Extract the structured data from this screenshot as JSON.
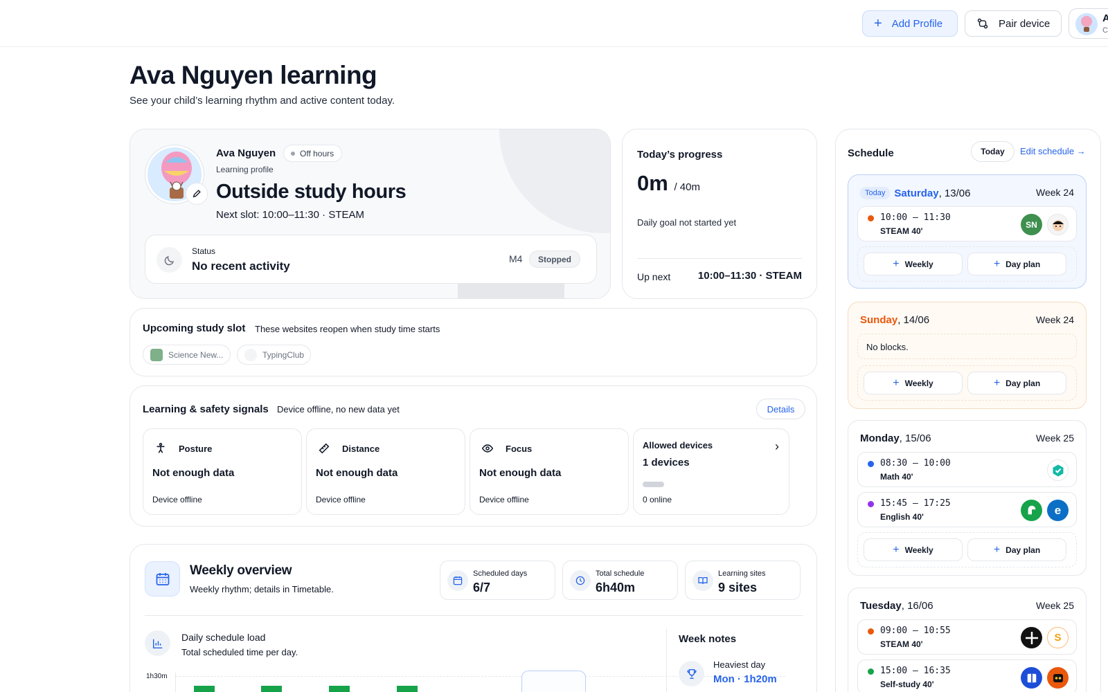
{
  "topbar": {
    "add_profile": "Add Profile",
    "pair_device": "Pair device",
    "user_initial": "A",
    "user_sub": "C"
  },
  "page": {
    "title": "Ava Nguyen learning",
    "subtitle": "See your child’s learning rhythm and active content today."
  },
  "profile": {
    "name": "Ava Nguyen",
    "badge": "Off hours",
    "label": "Learning profile",
    "headline": "Outside study hours",
    "next_slot": "Next slot: 10:00–11:30 · STEAM",
    "status_label": "Status",
    "status_value": "No recent activity",
    "device_code": "M4",
    "device_state": "Stopped"
  },
  "progress": {
    "title": "Today’s progress",
    "value": "0m",
    "goal": "/ 40m",
    "note": "Daily goal not started yet",
    "up_next_label": "Up next",
    "up_next_value": "10:00–11:30 · STEAM"
  },
  "upcoming": {
    "title": "Upcoming study slot",
    "subtitle": "These websites reopen when study time starts",
    "sites": [
      "Science New...",
      "TypingClub"
    ]
  },
  "signals": {
    "title": "Learning & safety signals",
    "subtitle": "Device offline, no new data yet",
    "details": "Details",
    "metrics": [
      {
        "label": "Posture",
        "value": "Not enough data",
        "sub": "Device offline",
        "icon": "posture-icon"
      },
      {
        "label": "Distance",
        "value": "Not enough data",
        "sub": "Device offline",
        "icon": "ruler-icon"
      },
      {
        "label": "Focus",
        "value": "Not enough data",
        "sub": "Device offline",
        "icon": "eye-icon"
      }
    ],
    "allowed": {
      "label": "Allowed devices",
      "value": "1 devices",
      "sub": "0 online"
    }
  },
  "weekly": {
    "title": "Weekly overview",
    "subtitle": "Weekly rhythm; details in Timetable.",
    "stats": [
      {
        "label": "Scheduled days",
        "value": "6/7",
        "icon": "calendar-icon"
      },
      {
        "label": "Total schedule",
        "value": "6h40m",
        "icon": "clock-icon"
      },
      {
        "label": "Learning sites",
        "value": "9 sites",
        "icon": "book-icon"
      }
    ],
    "chart_title": "Daily schedule load",
    "chart_sub": "Total scheduled time per day.",
    "y_tick": "1h30m",
    "notes_title": "Week notes",
    "heaviest_label": "Heaviest day",
    "heaviest_value": "Mon · 1h20m"
  },
  "chart_data": {
    "type": "bar",
    "title": "Daily schedule load",
    "y_tick_labels": [
      "1h30m"
    ],
    "y_max_minutes": 90,
    "bar_color": "#16a34a"
  },
  "schedule": {
    "title": "Schedule",
    "today_btn": "Today",
    "edit": "Edit schedule →",
    "weekly_btn": "Weekly",
    "dayplan_btn": "Day plan",
    "days": [
      {
        "badge": "Today",
        "day": "Saturday",
        "date": ", 13/06",
        "week": "Week 24",
        "slots": [
          {
            "time": "10:00 – 11:30",
            "subject": "STEAM 40'",
            "color": "#ea580c"
          }
        ]
      },
      {
        "day": "Sunday",
        "date": ", 14/06",
        "week": "Week 24",
        "empty": "No blocks."
      },
      {
        "day": "Monday",
        "date": ", 15/06",
        "week": "Week 25",
        "slots": [
          {
            "time": "08:30 – 10:00",
            "subject": "Math 40'",
            "color": "#2563eb"
          },
          {
            "time": "15:45 – 17:25",
            "subject": "English 40'",
            "color": "#9333ea"
          }
        ]
      },
      {
        "day": "Tuesday",
        "date": ", 16/06",
        "week": "Week 25",
        "slots": [
          {
            "time": "09:00 – 10:55",
            "subject": "STEAM 40'",
            "color": "#ea580c"
          },
          {
            "time": "15:00 – 16:35",
            "subject": "Self-study 40'",
            "color": "#16a34a"
          }
        ]
      }
    ]
  }
}
